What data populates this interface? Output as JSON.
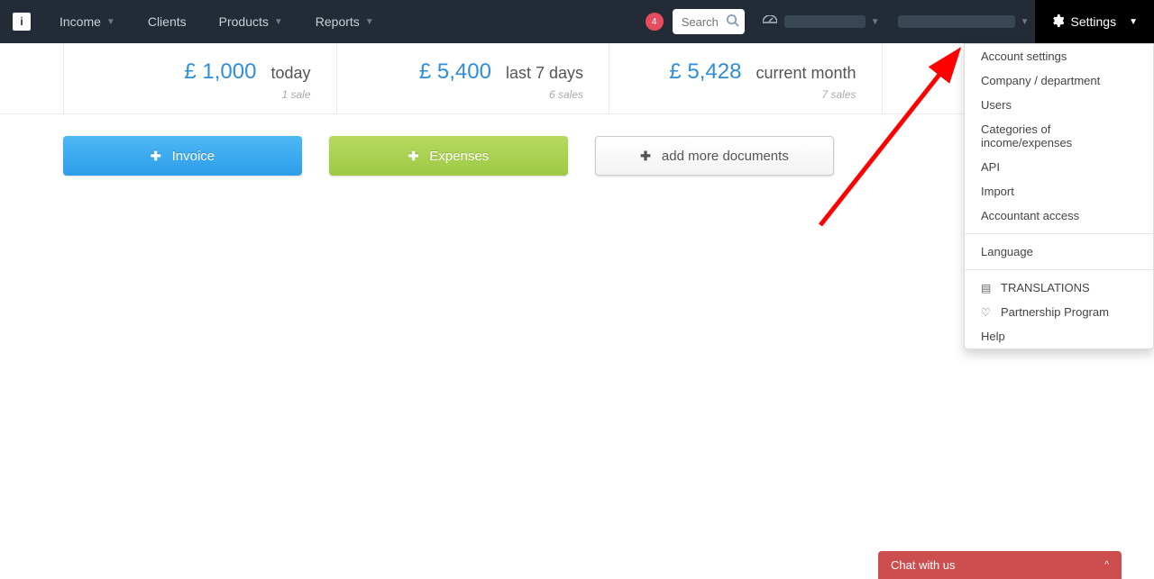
{
  "nav": {
    "income": "Income",
    "clients": "Clients",
    "products": "Products",
    "reports": "Reports",
    "badge": "4",
    "search_placeholder": "Search",
    "settings": "Settings"
  },
  "summary": [
    {
      "amount": "£ 1,000",
      "label": "today",
      "sub": "1 sale"
    },
    {
      "amount": "£ 5,400",
      "label": "last 7 days",
      "sub": "6 sales"
    },
    {
      "amount": "£ 5,428",
      "label": "current month",
      "sub": "7 sales"
    },
    {
      "amount": "£",
      "label": "",
      "sub": ""
    }
  ],
  "actions": {
    "invoice": "Invoice",
    "expenses": "Expenses",
    "more": "add more documents"
  },
  "dropdown": {
    "account": "Account settings",
    "company": "Company / department",
    "users": "Users",
    "categories": "Categories of income/expenses",
    "api": "API",
    "import": "Import",
    "accountant": "Accountant access",
    "language": "Language",
    "translations": "TRANSLATIONS",
    "partnership": "Partnership Program",
    "help": "Help"
  },
  "chat": {
    "label": "Chat with us",
    "toggle": "^"
  }
}
